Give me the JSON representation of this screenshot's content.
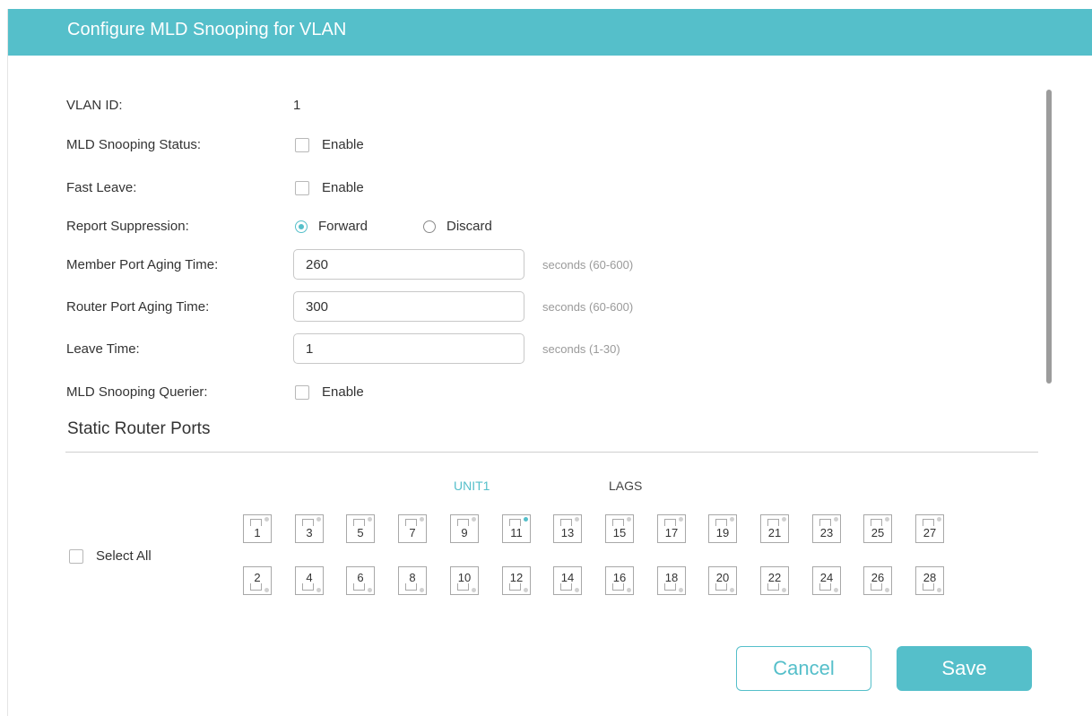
{
  "dialog": {
    "title": "Configure MLD Snooping for VLAN"
  },
  "form": {
    "vlan_id": {
      "label": "VLAN ID:",
      "value": "1"
    },
    "mld_snooping_status": {
      "label": "MLD Snooping Status:",
      "option": "Enable",
      "checked": false
    },
    "fast_leave": {
      "label": "Fast Leave:",
      "option": "Enable",
      "checked": false
    },
    "report_suppression": {
      "label": "Report Suppression:",
      "options": [
        "Forward",
        "Discard"
      ],
      "selected": "Forward"
    },
    "member_port_aging_time": {
      "label": "Member Port Aging Time:",
      "value": "260",
      "hint": "seconds (60-600)"
    },
    "router_port_aging_time": {
      "label": "Router Port Aging Time:",
      "value": "300",
      "hint": "seconds (60-600)"
    },
    "leave_time": {
      "label": "Leave Time:",
      "value": "1",
      "hint": "seconds (1-30)"
    },
    "mld_snooping_querier": {
      "label": "MLD Snooping Querier:",
      "option": "Enable",
      "checked": false
    }
  },
  "static_router_ports": {
    "title": "Static Router Ports",
    "tabs": [
      "UNIT1",
      "LAGS"
    ],
    "active_tab": "UNIT1",
    "select_all_label": "Select All",
    "top_row": [
      "1",
      "3",
      "5",
      "7",
      "9",
      "11",
      "13",
      "15",
      "17",
      "19",
      "21",
      "23",
      "25",
      "27"
    ],
    "bottom_row": [
      "2",
      "4",
      "6",
      "8",
      "10",
      "12",
      "14",
      "16",
      "18",
      "20",
      "22",
      "24",
      "26",
      "28"
    ],
    "active_ports": [
      "11"
    ]
  },
  "buttons": {
    "cancel": "Cancel",
    "save": "Save"
  },
  "colors": {
    "accent": "#55bfca",
    "led_idle": "#d0d0d0"
  }
}
